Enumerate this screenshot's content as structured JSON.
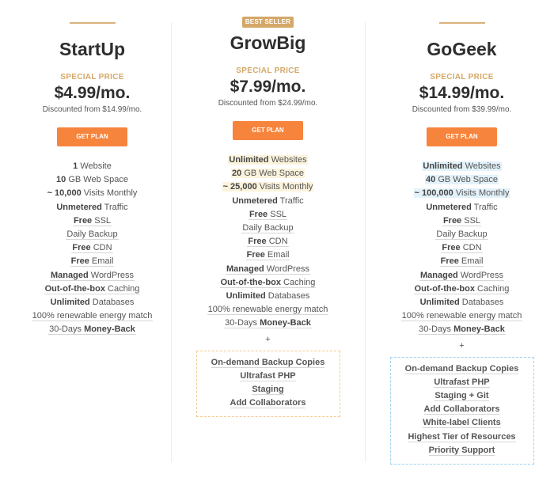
{
  "plans": [
    {
      "name": "StartUp",
      "badge": null,
      "special_label": "SPECIAL PRICE",
      "price": "$4.99/mo.",
      "discount": "Discounted from $14.99/mo.",
      "button": "GET PLAN",
      "features": [
        {
          "bold": "1",
          "text": " Website",
          "underline": false,
          "highlight": false
        },
        {
          "bold": "10",
          "text": " GB Web Space",
          "underline": false,
          "highlight": false
        },
        {
          "bold": "~ 10,000",
          "text": " Visits Monthly",
          "underline": false,
          "highlight": false
        },
        {
          "bold": "Unmetered",
          "text": " Traffic",
          "underline": false,
          "highlight": false
        },
        {
          "bold": "Free",
          "text": " SSL",
          "underline": true,
          "highlight": false
        },
        {
          "bold": "",
          "text": "Daily Backup",
          "underline": true,
          "highlight": false
        },
        {
          "bold": "Free",
          "text": " CDN",
          "underline": true,
          "highlight": false
        },
        {
          "bold": "Free",
          "text": " Email",
          "underline": true,
          "highlight": false
        },
        {
          "bold": "Managed",
          "text": " WordPress",
          "underline": true,
          "highlight": false
        },
        {
          "bold": "Out-of-the-box",
          "text": " Caching",
          "underline": true,
          "highlight": false
        },
        {
          "bold": "Unlimited",
          "text": " Databases",
          "underline": false,
          "highlight": false
        },
        {
          "bold": "",
          "text": "100% renewable energy match",
          "underline": true,
          "highlight": false
        },
        {
          "bold": "Money-Back",
          "text": "30-Days ",
          "underline": true,
          "highlight": false,
          "bold_after": true
        }
      ],
      "extras": []
    },
    {
      "name": "GrowBig",
      "badge": "BEST SELLER",
      "special_label": "SPECIAL PRICE",
      "price": "$7.99/mo.",
      "discount": "Discounted from $24.99/mo.",
      "button": "GET PLAN",
      "features": [
        {
          "bold": "Unlimited",
          "text": " Websites",
          "underline": false,
          "highlight": true
        },
        {
          "bold": "20",
          "text": " GB Web Space",
          "underline": false,
          "highlight": true
        },
        {
          "bold": "~ 25,000",
          "text": " Visits Monthly",
          "underline": false,
          "highlight": true
        },
        {
          "bold": "Unmetered",
          "text": " Traffic",
          "underline": false,
          "highlight": false
        },
        {
          "bold": "Free",
          "text": " SSL",
          "underline": true,
          "highlight": false
        },
        {
          "bold": "",
          "text": "Daily Backup",
          "underline": true,
          "highlight": false
        },
        {
          "bold": "Free",
          "text": " CDN",
          "underline": true,
          "highlight": false
        },
        {
          "bold": "Free",
          "text": " Email",
          "underline": true,
          "highlight": false
        },
        {
          "bold": "Managed",
          "text": " WordPress",
          "underline": true,
          "highlight": false
        },
        {
          "bold": "Out-of-the-box",
          "text": " Caching",
          "underline": true,
          "highlight": false
        },
        {
          "bold": "Unlimited",
          "text": " Databases",
          "underline": false,
          "highlight": false
        },
        {
          "bold": "",
          "text": "100% renewable energy match",
          "underline": true,
          "highlight": false
        },
        {
          "bold": "Money-Back",
          "text": "30-Days ",
          "underline": true,
          "highlight": false,
          "bold_after": true
        }
      ],
      "plus": "+",
      "extras": [
        "On-demand Backup Copies",
        "Ultrafast PHP",
        "Staging",
        "Add Collaborators"
      ],
      "extras_color": "#f3c98c",
      "highlight_color": "#fbf3dc"
    },
    {
      "name": "GoGeek",
      "badge": null,
      "special_label": "SPECIAL PRICE",
      "price": "$14.99/mo.",
      "discount": "Discounted from $39.99/mo.",
      "button": "GET PLAN",
      "features": [
        {
          "bold": "Unlimited",
          "text": " Websites",
          "underline": false,
          "highlight": true
        },
        {
          "bold": "40",
          "text": " GB Web Space",
          "underline": false,
          "highlight": true
        },
        {
          "bold": "~ 100,000",
          "text": " Visits Monthly",
          "underline": false,
          "highlight": true
        },
        {
          "bold": "Unmetered",
          "text": " Traffic",
          "underline": false,
          "highlight": false
        },
        {
          "bold": "Free",
          "text": " SSL",
          "underline": true,
          "highlight": false
        },
        {
          "bold": "",
          "text": "Daily Backup",
          "underline": true,
          "highlight": false
        },
        {
          "bold": "Free",
          "text": " CDN",
          "underline": true,
          "highlight": false
        },
        {
          "bold": "Free",
          "text": " Email",
          "underline": true,
          "highlight": false
        },
        {
          "bold": "Managed",
          "text": " WordPress",
          "underline": true,
          "highlight": false
        },
        {
          "bold": "Out-of-the-box",
          "text": " Caching",
          "underline": true,
          "highlight": false
        },
        {
          "bold": "Unlimited",
          "text": " Databases",
          "underline": false,
          "highlight": false
        },
        {
          "bold": "",
          "text": "100% renewable energy match",
          "underline": true,
          "highlight": false
        },
        {
          "bold": "Money-Back",
          "text": "30-Days ",
          "underline": true,
          "highlight": false,
          "bold_after": true
        }
      ],
      "plus": "+",
      "extras": [
        "On-demand Backup Copies",
        "Ultrafast PHP",
        "Staging + Git",
        "Add Collaborators",
        "White-label Clients",
        "Highest Tier of Resources",
        "Priority Support"
      ],
      "extras_color": "#9fd3ef",
      "highlight_color": "#e3f2fa"
    }
  ],
  "colors": {
    "accent_gold": "#d4a868",
    "button_orange": "#f6843c",
    "heading": "#2e2e2e"
  }
}
